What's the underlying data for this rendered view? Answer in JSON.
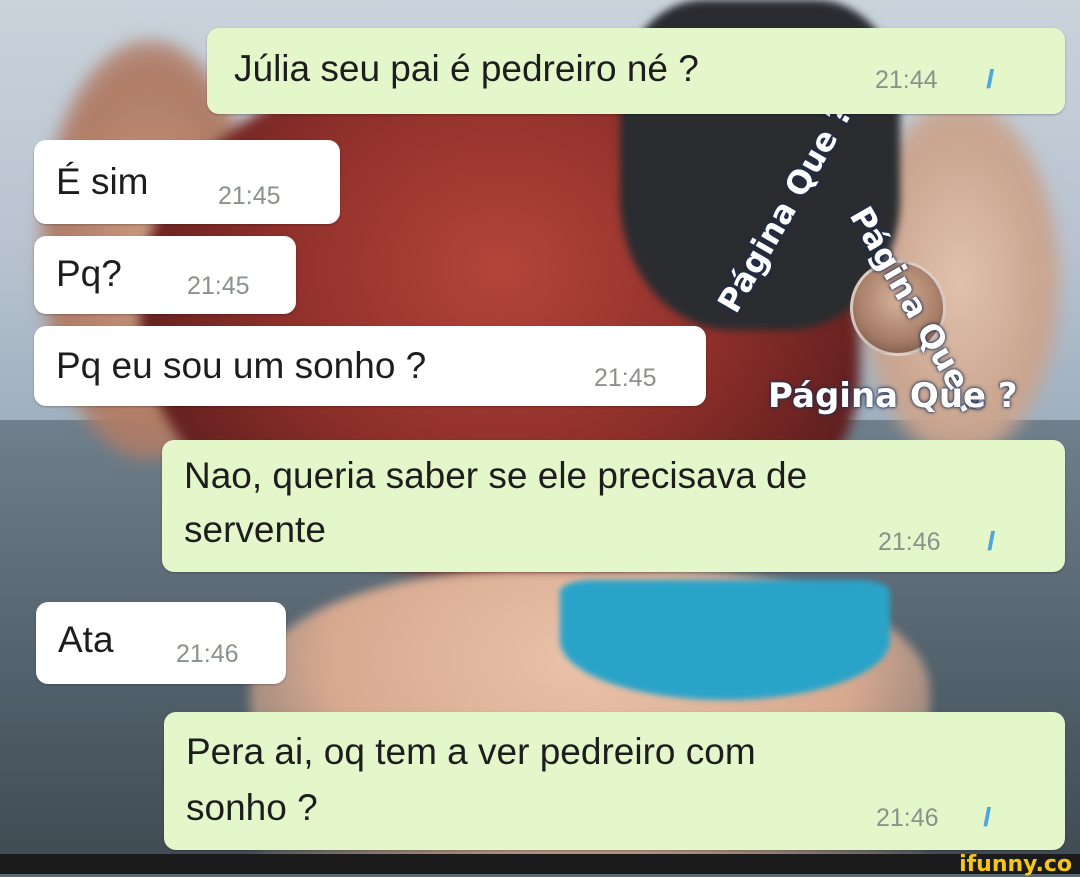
{
  "messages": [
    {
      "text": "Júlia seu pai é pedreiro né ?",
      "time": "21:44",
      "ticks": "//"
    },
    {
      "text": "É sim",
      "time": "21:45"
    },
    {
      "text": "Pq?",
      "time": "21:45"
    },
    {
      "text": "Pq eu sou um sonho ?",
      "time": "21:45"
    },
    {
      "line1": "Nao, queria saber se ele precisava de",
      "line2": "servente",
      "time": "21:46",
      "ticks": "//"
    },
    {
      "text": "Ata",
      "time": "21:46"
    },
    {
      "line1": "Pera ai, oq tem a ver pedreiro com",
      "line2": "sonho ?",
      "time": "21:46",
      "ticks": "//"
    }
  ],
  "watermark": {
    "text1": "Página Que ?",
    "text2": "Página Que ?",
    "text3": "Página Que ?"
  },
  "footer": {
    "brand": "ifunny.co"
  },
  "colors": {
    "sent": "#e3f7cb",
    "received": "#ffffff",
    "ticks": "#4fa6dc"
  }
}
